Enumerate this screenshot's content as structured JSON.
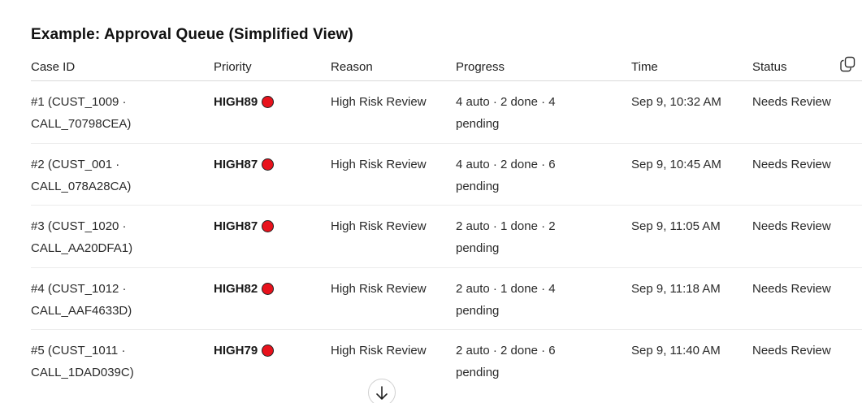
{
  "title": "Example: Approval Queue (Simplified View)",
  "columns": [
    "Case ID",
    "Priority",
    "Reason",
    "Progress",
    "Time",
    "Status"
  ],
  "rows": [
    {
      "case_id": "#1 (CUST_1009 · CALL_70798CEA)",
      "priority": "HIGH89",
      "reason": "High Risk Review",
      "progress": "4 auto · 2 done · 4 pending",
      "time": "Sep 9, 10:32 AM",
      "status": "Needs Review"
    },
    {
      "case_id": "#2 (CUST_001 · CALL_078A28CA)",
      "priority": "HIGH87",
      "reason": "High Risk Review",
      "progress": "4 auto · 2 done · 6 pending",
      "time": "Sep 9, 10:45 AM",
      "status": "Needs Review"
    },
    {
      "case_id": "#3 (CUST_1020 · CALL_AA20DFA1)",
      "priority": "HIGH87",
      "reason": "High Risk Review",
      "progress": "2 auto · 1 done · 2 pending",
      "time": "Sep 9, 11:05 AM",
      "status": "Needs Review"
    },
    {
      "case_id": "#4 (CUST_1012 · CALL_AAF4633D)",
      "priority": "HIGH82",
      "reason": "High Risk Review",
      "progress": "2 auto · 1 done · 4 pending",
      "time": "Sep 9, 11:18 AM",
      "status": "Needs Review"
    },
    {
      "case_id": "#5 (CUST_1011 · CALL_1DAD039C)",
      "priority": "HIGH79",
      "reason": "High Risk Review",
      "progress": "2 auto · 2 done · 6 pending",
      "time": "Sep 9, 11:40 AM",
      "status": "Needs Review"
    }
  ],
  "icons": {
    "priority_dot": "red-circle-icon",
    "copy": "copy-icon",
    "scroll_down": "arrow-down-icon"
  },
  "colors": {
    "priority_dot": "#e8121c"
  }
}
